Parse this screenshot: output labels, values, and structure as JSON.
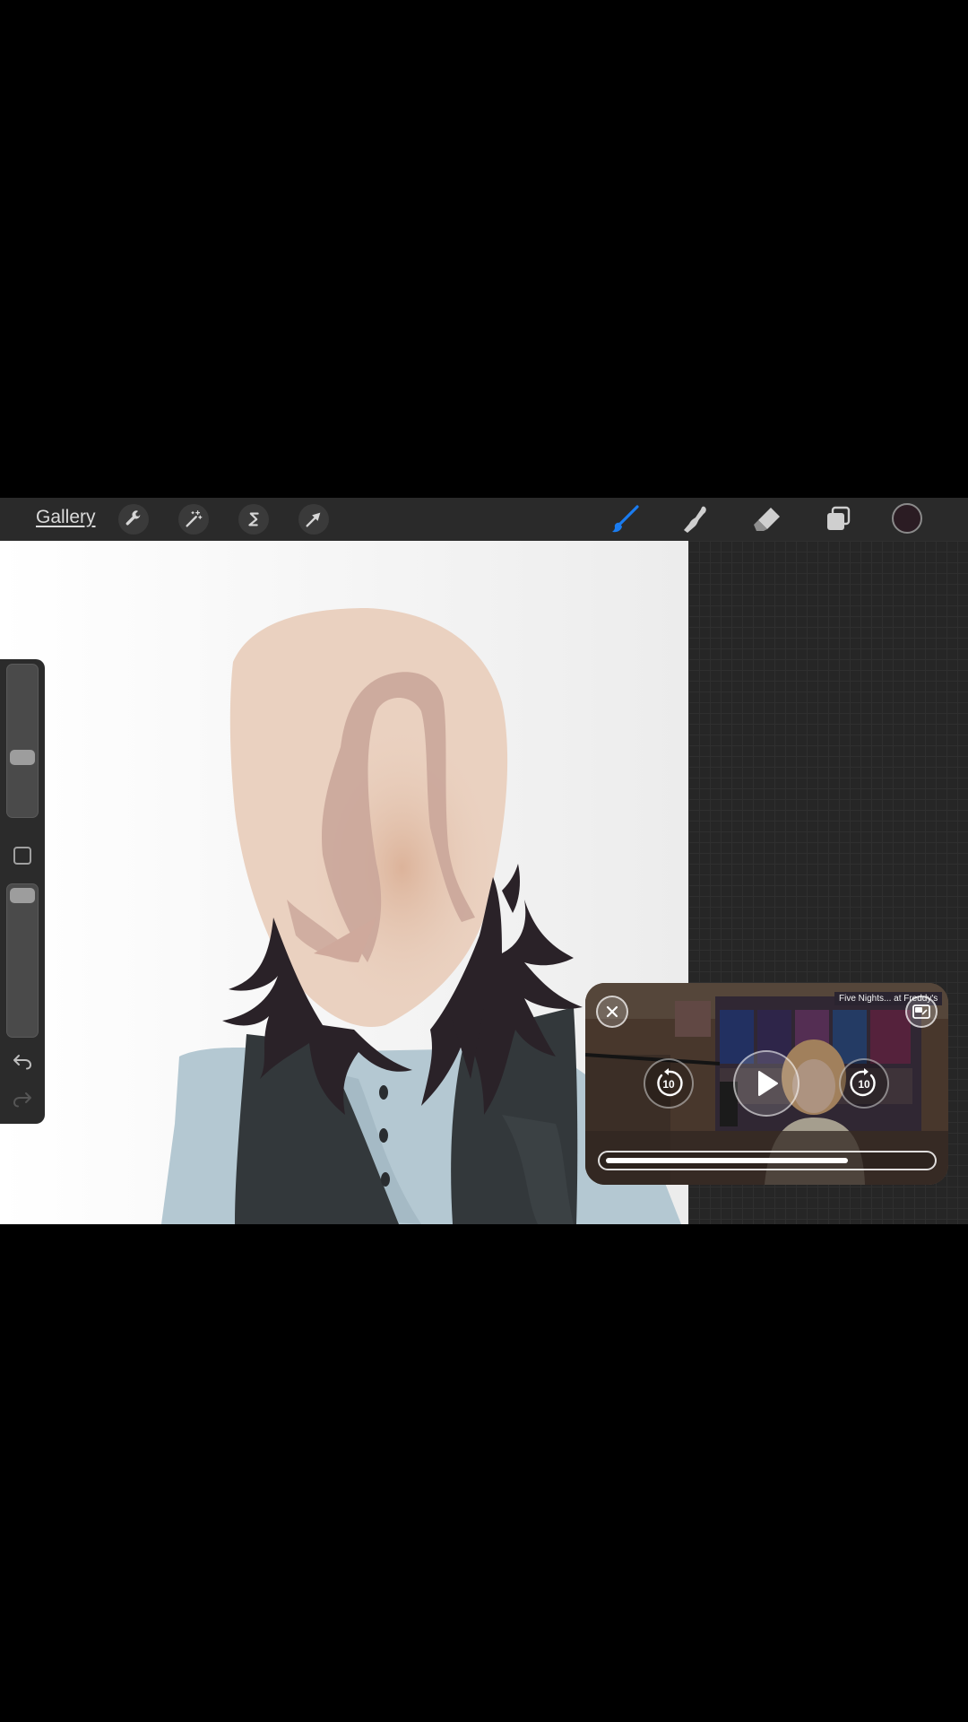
{
  "toolbar": {
    "gallery_label": "Gallery",
    "actions_icon": "wrench-icon",
    "adjustments_icon": "magic-wand-icon",
    "selection_icon": "selection-s-icon",
    "transform_icon": "arrow-cursor-icon",
    "brush_icon": "brush-icon",
    "smudge_icon": "smudge-finger-icon",
    "eraser_icon": "eraser-icon",
    "layers_icon": "layers-icon",
    "current_color": "#2b1c23",
    "active_tool": "brush",
    "active_color": "#1a7cf0"
  },
  "sidebar": {
    "brush_size_level": 0.55,
    "opacity_level": 0.05,
    "modify_icon": "square-icon",
    "undo_icon": "undo-icon",
    "redo_icon": "redo-icon"
  },
  "pip_video": {
    "close_icon": "close-icon",
    "expand_icon": "pip-restore-icon",
    "skip_back_label": "10",
    "skip_forward_label": "10",
    "play_icon": "play-icon",
    "progress": 0.75,
    "background_sign_text": "Five Nights... at Freddy's"
  }
}
